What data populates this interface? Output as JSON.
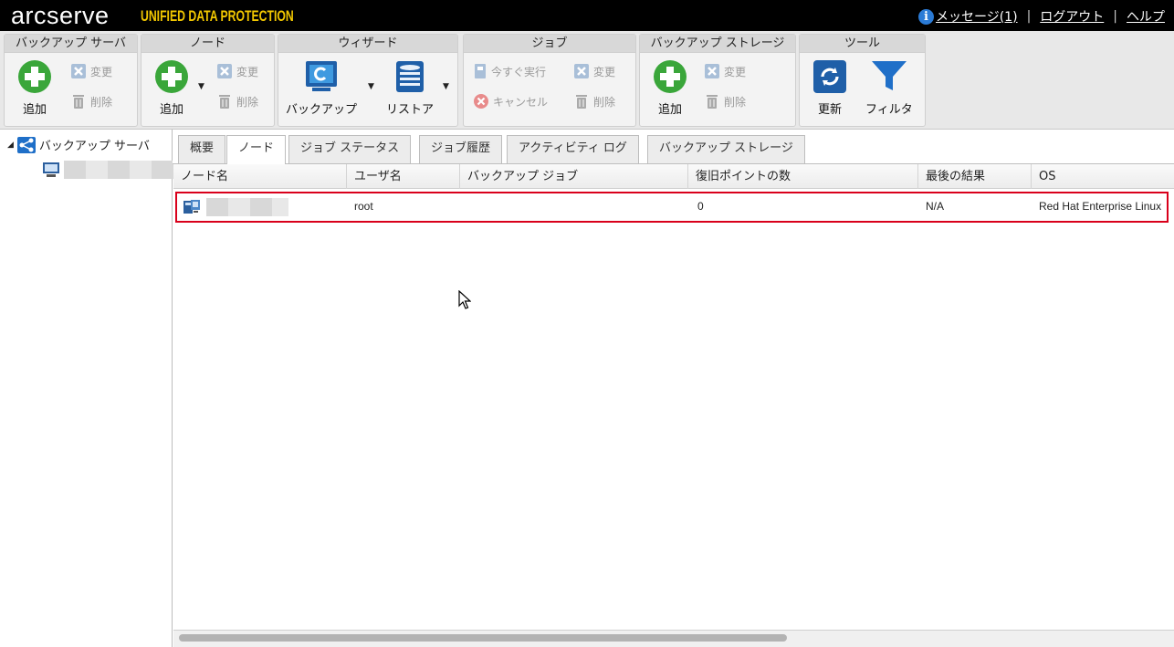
{
  "header": {
    "logo": "arcserve",
    "logo_sub": "UNIFIED DATA PROTECTION",
    "messages": "メッセージ(1)",
    "logout": "ログアウト",
    "help": "ヘルプ",
    "separator": "|"
  },
  "ribbon": {
    "backup_server": {
      "title": "バックアップ サーバ",
      "add": "追加",
      "modify": "変更",
      "delete": "削除"
    },
    "node": {
      "title": "ノード",
      "add": "追加",
      "modify": "変更",
      "delete": "削除"
    },
    "wizard": {
      "title": "ウィザード",
      "backup": "バックアップ",
      "restore": "リストア"
    },
    "job": {
      "title": "ジョブ",
      "run_now": "今すぐ実行",
      "modify": "変更",
      "cancel": "キャンセル",
      "delete": "削除"
    },
    "backup_storage": {
      "title": "バックアップ ストレージ",
      "add": "追加",
      "modify": "変更",
      "delete": "削除"
    },
    "tools": {
      "title": "ツール",
      "refresh": "更新",
      "filter": "フィルタ"
    }
  },
  "tree": {
    "root": "バックアップ サーバ"
  },
  "tabs": [
    "概要",
    "ノード",
    "ジョブ ステータス",
    "ジョブ履歴",
    "アクティビティ ログ",
    "バックアップ ストレージ"
  ],
  "active_tab": "ノード",
  "grid": {
    "columns": [
      "ノード名",
      "ユーザ名",
      "バックアップ ジョブ",
      "復旧ポイントの数",
      "最後の結果",
      "OS"
    ],
    "rows": [
      {
        "user": "root",
        "job": "",
        "points": "0",
        "result": "N/A",
        "os": "Red Hat Enterprise Linux"
      }
    ]
  },
  "colors": {
    "accent": "#f2c700",
    "selection_border": "#d9001b",
    "add_green": "#3aa63a"
  }
}
